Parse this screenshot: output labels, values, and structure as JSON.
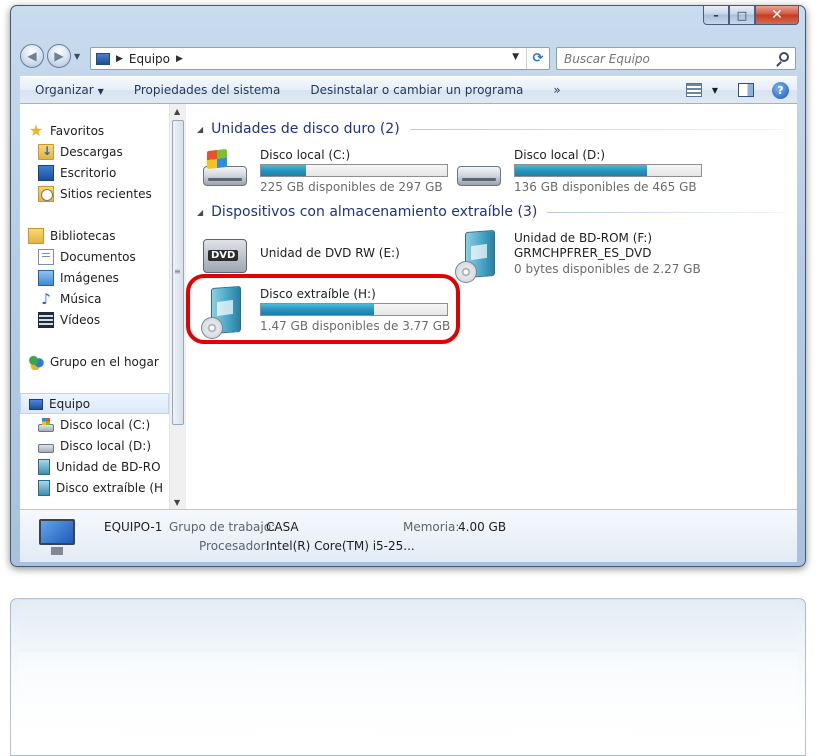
{
  "window": {
    "controls": {
      "minimize": "–",
      "maximize": "□",
      "close": "✕"
    }
  },
  "address": {
    "breadcrumb": "Equipo",
    "search_placeholder": "Buscar Equipo"
  },
  "toolbar": {
    "organize": "Organizar",
    "system_properties": "Propiedades del sistema",
    "uninstall": "Desinstalar o cambiar un programa",
    "more": "»"
  },
  "sidebar": {
    "favorites": {
      "label": "Favoritos",
      "items": [
        "Descargas",
        "Escritorio",
        "Sitios recientes"
      ]
    },
    "libraries": {
      "label": "Bibliotecas",
      "items": [
        "Documentos",
        "Imágenes",
        "Música",
        "Vídeos"
      ]
    },
    "homegroup": "Grupo en el hogar",
    "computer": {
      "label": "Equipo",
      "items": [
        "Disco local (C:)",
        "Disco local (D:)",
        "Unidad de BD-RO",
        "Disco extraíble (H"
      ]
    }
  },
  "sections": {
    "hard_disks": {
      "title": "Unidades de disco duro (2)",
      "drives": [
        {
          "name": "Disco local (C:)",
          "free_text": "225 GB disponibles de 297 GB",
          "used_fraction": 0.24
        },
        {
          "name": "Disco local (D:)",
          "free_text": "136 GB disponibles de 465 GB",
          "used_fraction": 0.71
        }
      ]
    },
    "removable": {
      "title": "Dispositivos con almacenamiento extraíble (3)",
      "dvd": {
        "name": "Unidad de DVD RW (E:)",
        "icon_label": "DVD"
      },
      "bd": {
        "name": "Unidad de BD-ROM (F:)",
        "volume": "GRMCHPFRER_ES_DVD",
        "free_text": "0 bytes disponibles de 2.27 GB"
      },
      "usb": {
        "name": "Disco extraíble (H:)",
        "free_text": "1.47 GB disponibles de 3.77 GB",
        "used_fraction": 0.61
      }
    }
  },
  "details": {
    "computer_name": "EQUIPO-1",
    "workgroup_label": "Grupo de trabajo:",
    "workgroup_value": "CASA",
    "memory_label": "Memoria:",
    "memory_value": "4.00 GB",
    "processor_label": "Procesador:",
    "processor_value": "Intel(R) Core(TM) i5-25..."
  },
  "colors": {
    "highlight_ring": "#e50000",
    "section_title": "#1e3287",
    "bar_fill": "#2795bf"
  }
}
